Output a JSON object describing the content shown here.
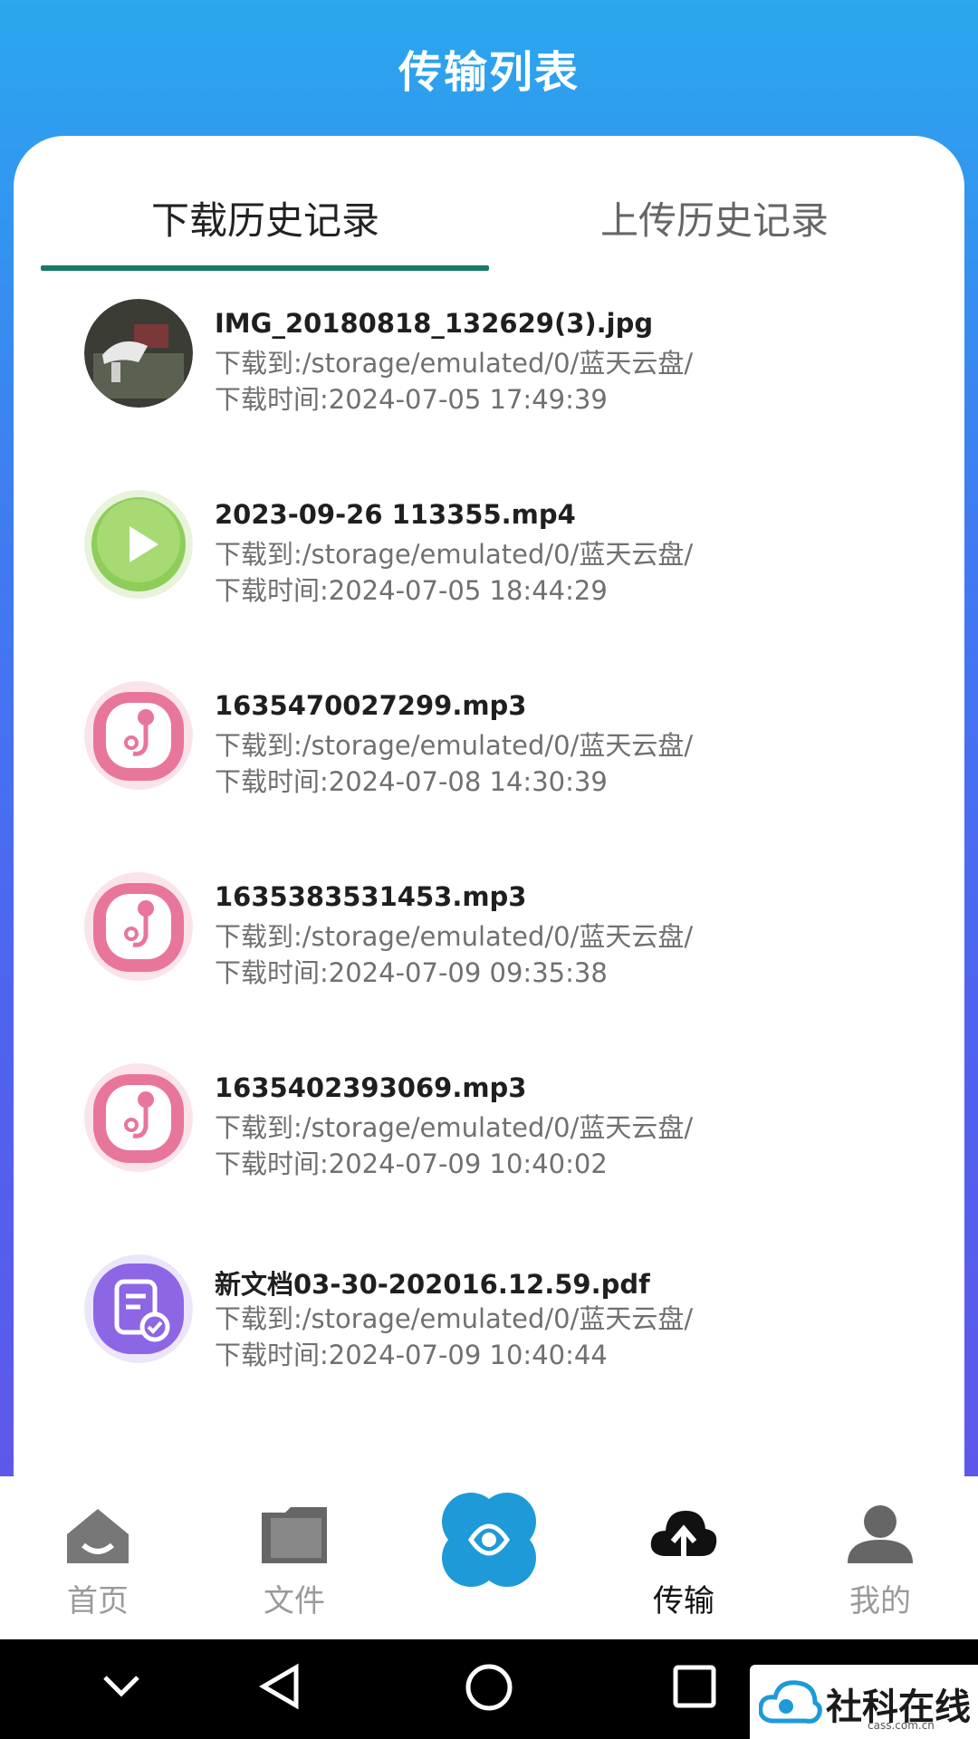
{
  "header": {
    "title": "传输列表"
  },
  "tabs": [
    {
      "label": "下载历史记录",
      "active": true
    },
    {
      "label": "上传历史记录",
      "active": false
    }
  ],
  "downloads": [
    {
      "icon": "image-thumbnail-icon",
      "name": "IMG_20180818_132629(3).jpg",
      "path": "下载到:/storage/emulated/0/蓝天云盘/",
      "time": "下载时间:2024-07-05 17:49:39"
    },
    {
      "icon": "video-file-icon",
      "name": "2023-09-26 113355.mp4",
      "path": "下载到:/storage/emulated/0/蓝天云盘/",
      "time": "下载时间:2024-07-05 18:44:29"
    },
    {
      "icon": "music-file-icon",
      "name": "1635470027299.mp3",
      "path": "下载到:/storage/emulated/0/蓝天云盘/",
      "time": "下载时间:2024-07-08 14:30:39"
    },
    {
      "icon": "music-file-icon",
      "name": "1635383531453.mp3",
      "path": "下载到:/storage/emulated/0/蓝天云盘/",
      "time": "下载时间:2024-07-09 09:35:38"
    },
    {
      "icon": "music-file-icon",
      "name": "1635402393069.mp3",
      "path": "下载到:/storage/emulated/0/蓝天云盘/",
      "time": "下载时间:2024-07-09 10:40:02"
    },
    {
      "icon": "document-file-icon",
      "name": "新文档03-30-202016.12.59.pdf",
      "path": "下载到:/storage/emulated/0/蓝天云盘/",
      "time": "下载时间:2024-07-09 10:40:44"
    }
  ],
  "bottom_nav": [
    {
      "label": "首页",
      "icon": "home-icon"
    },
    {
      "label": "文件",
      "icon": "folder-icon"
    },
    {
      "label": "",
      "icon": "app-logo-icon"
    },
    {
      "label": "传输",
      "icon": "cloud-upload-icon",
      "active": true
    },
    {
      "label": "我的",
      "icon": "user-icon"
    }
  ],
  "colors": {
    "tab_underline": "#177a6a",
    "header_gradient_top": "#2aa7ee",
    "header_gradient_bottom": "#5e58ea"
  },
  "watermark": {
    "text": "社科在线",
    "subtext": "cass.com.cn"
  }
}
